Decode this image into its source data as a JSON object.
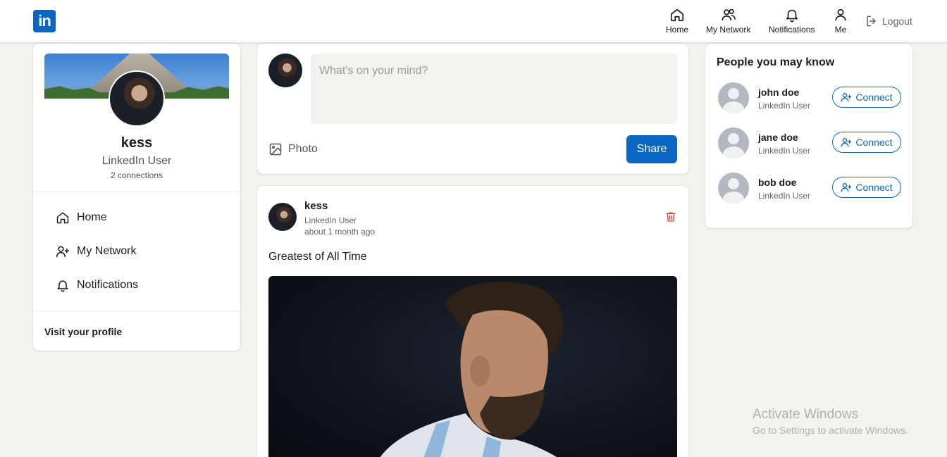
{
  "header": {
    "logo_text": "in",
    "nav": [
      {
        "label": "Home",
        "icon": "home-icon"
      },
      {
        "label": "My Network",
        "icon": "network-icon"
      },
      {
        "label": "Notifications",
        "icon": "bell-icon"
      },
      {
        "label": "Me",
        "icon": "user-icon"
      }
    ],
    "logout_label": "Logout"
  },
  "profile": {
    "name": "kess",
    "title": "LinkedIn User",
    "connections": "2 connections",
    "menu": [
      {
        "label": "Home",
        "icon": "home-icon"
      },
      {
        "label": "My Network",
        "icon": "add-user-icon"
      },
      {
        "label": "Notifications",
        "icon": "bell-icon"
      }
    ],
    "visit_label": "Visit your profile"
  },
  "composer": {
    "placeholder": "What's on your mind?",
    "photo_label": "Photo",
    "share_label": "Share"
  },
  "post": {
    "author": "kess",
    "subtitle": "LinkedIn User",
    "time": "about 1 month ago",
    "text": "Greatest of All Time"
  },
  "suggestions": {
    "title": "People you may know",
    "people": [
      {
        "name": "john doe",
        "role": "LinkedIn User",
        "action": "Connect"
      },
      {
        "name": "jane doe",
        "role": "LinkedIn User",
        "action": "Connect"
      },
      {
        "name": "bob doe",
        "role": "LinkedIn User",
        "action": "Connect"
      }
    ]
  },
  "watermark": {
    "line1": "Activate Windows",
    "line2": "Go to Settings to activate Windows."
  },
  "colors": {
    "brand": "#0a66c2",
    "background": "#f3f2ef",
    "danger": "#e03b3b"
  }
}
